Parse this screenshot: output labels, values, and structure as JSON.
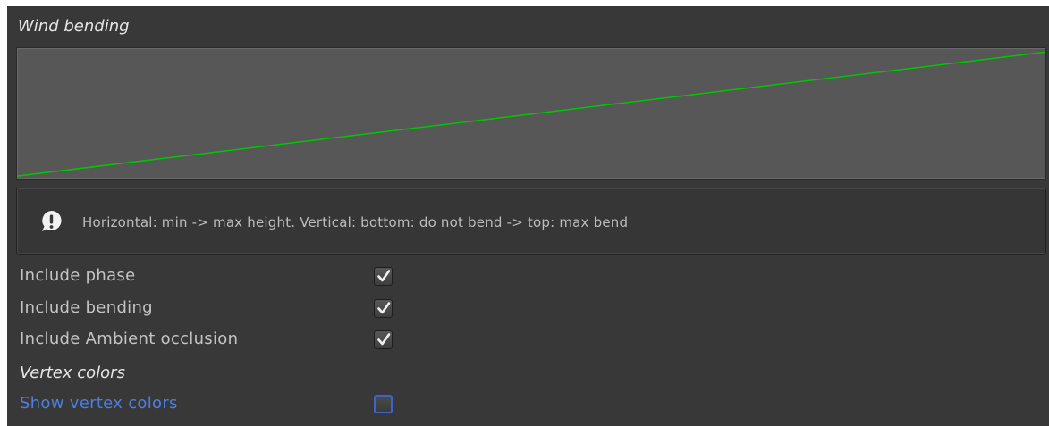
{
  "wind_bending": {
    "title": "Wind bending",
    "curve": {
      "line_color": "#00c800",
      "start_value": 0.02,
      "end_value": 0.97
    }
  },
  "help": {
    "icon": "info-bubble-icon",
    "text": "Horizontal: min -> max height. Vertical: bottom: do not bend -> top: max bend"
  },
  "options": {
    "include_phase": {
      "label": "Include phase",
      "checked": true
    },
    "include_bending": {
      "label": "Include bending",
      "checked": true
    },
    "include_ao": {
      "label": "Include Ambient occlusion",
      "checked": true
    }
  },
  "vertex_colors": {
    "title": "Vertex colors",
    "show": {
      "label": "Show vertex colors",
      "checked": false
    }
  },
  "colors": {
    "panel_bg": "#383838",
    "link_blue": "#4d7ee0",
    "curve_green": "#00c800"
  }
}
